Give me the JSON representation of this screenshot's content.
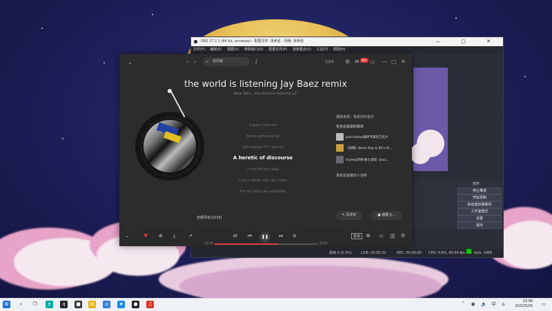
{
  "obs": {
    "title": "OBS 27.2.1 (64 bit, windows) - 配置文件: 未命名 - 场景: 未命名",
    "menu": [
      "文件(F)",
      "编辑(E)",
      "视图(V)",
      "停靠窗口(D)",
      "配置文件(P)",
      "场景集合(S)",
      "工具(T)",
      "帮助(H)"
    ],
    "controls_title": "控件",
    "buttons": [
      "停止推流",
      "开始录制",
      "启动虚拟摄像机",
      "工作室模式",
      "设置",
      "退出"
    ],
    "status": {
      "dropped": "丢帧 0 (0.0%)",
      "live": "LIVE: 00:00:32",
      "rec": "REC: 00:00:00",
      "cpu": "CPU: 0.9%, 60.00 fps",
      "bitrate": "kb/s: 1069"
    }
  },
  "player": {
    "search_text": "访问城",
    "user_label": "云音乐",
    "badge": "99+",
    "song_title": "the world is listening Jay Baez remix",
    "song_sub": "Akua Naru - the world is listening 12\"",
    "lyrics": [
      {
        "text": "Guess I told one",
        "current": false
      },
      {
        "text": "Some come and go",
        "current": false
      },
      {
        "text": "Self labeled **** and ho",
        "current": false
      },
      {
        "text": "A heretic of discourse",
        "current": true
      },
      {
        "text": "I turn off the radio",
        "current": false
      },
      {
        "text": "I can't relate, nor can I hate",
        "current": false
      },
      {
        "text": "For the ways we negotiate",
        "current": false
      }
    ],
    "side_heading": "播放来源：我喜欢的音乐",
    "side_subheading": "包含这首歌的歌单",
    "playlists": [
      "Jazz hiphop随听专属社交名片",
      "《劲爆》Boom Bap & 80's Ol...",
      "HipHop风格·爵士说唱（Jazz..."
    ],
    "side_footer": "喜欢这首歌的人也听",
    "comments": "全部评论(1033)",
    "write_comment": "写评论",
    "user_pill": "姚颖 JI...",
    "time_elapsed": "02:19",
    "time_total": "03:51",
    "progress": 0.61,
    "lyric_btn": "词"
  },
  "taskbar": {
    "time": "23:08",
    "date": "2022/5/26",
    "lang": "中"
  }
}
